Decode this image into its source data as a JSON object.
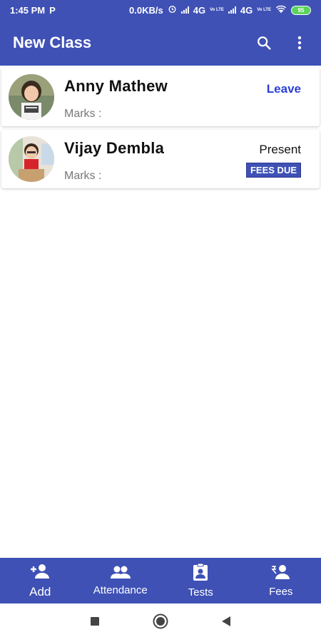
{
  "statusbar": {
    "time": "1:45 PM",
    "p_icon": "P",
    "speed": "0.0KB/s",
    "net1": "4G",
    "net2": "4G",
    "volte": "Vo LTE",
    "battery": "95"
  },
  "appbar": {
    "title": "New Class",
    "search_icon": "search-icon",
    "more_icon": "more-vert-icon"
  },
  "students": [
    {
      "name": "Anny Mathew",
      "marks_label": "Marks :",
      "status": "Leave",
      "badge": ""
    },
    {
      "name": "Vijay Dembla",
      "marks_label": "Marks :",
      "status": "Present",
      "badge": "FEES DUE"
    }
  ],
  "bottom_nav": [
    {
      "label": "Add",
      "icon": "add-person-icon"
    },
    {
      "label": "Attendance",
      "icon": "people-icon"
    },
    {
      "label": "Tests",
      "icon": "clipboard-person-icon"
    },
    {
      "label": "Fees",
      "icon": "person-money-icon"
    }
  ],
  "colors": {
    "primary": "#3f51b5",
    "leave": "#2a3fd6",
    "badge_bg": "#3f51b5"
  }
}
